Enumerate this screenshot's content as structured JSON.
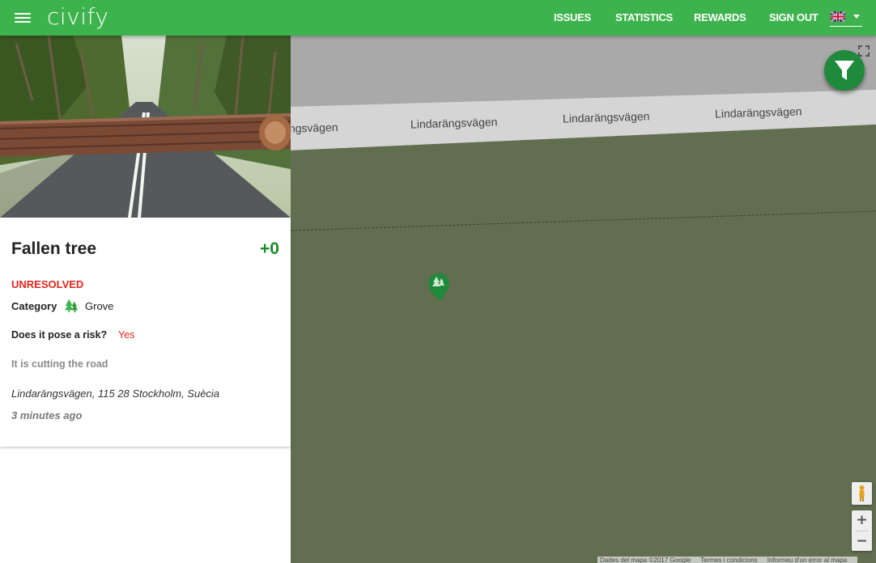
{
  "app": {
    "logo": "civify"
  },
  "nav": {
    "issues": "ISSUES",
    "statistics": "STATISTICS",
    "rewards": "REWARDS",
    "sign_out": "SIGN OUT"
  },
  "issue": {
    "title": "Fallen tree",
    "votes": "+0",
    "status": "UNRESOLVED",
    "category_label": "Category",
    "category_value": "Grove",
    "risk_question": "Does it pose a risk?",
    "risk_answer": "Yes",
    "description": "It is cutting the road",
    "address": "Lindarängsvägen, 115 28 Stockholm, Suècia",
    "time_ago": "3 minutes ago"
  },
  "map": {
    "road_labels": [
      "ängsvägen",
      "Lindarängsvägen",
      "Lindarängsvägen",
      "Lindarängsvägen"
    ],
    "zoom_in": "+",
    "zoom_out": "−",
    "attribution": {
      "data": "Dades del mapa ©2017 Google",
      "terms": "Termes i condicions",
      "report": "Informeu d'un error al mapa"
    }
  },
  "colors": {
    "header": "#3db34d",
    "status": "#e3261c",
    "votes": "#1e8a28",
    "map_background": "#616e4f",
    "fab": "#1f8a3c"
  },
  "icons": {
    "menu": "menu-icon",
    "flag": "uk-flag-icon",
    "filter": "filter-icon",
    "category": "trees-icon",
    "marker": "map-marker-icon",
    "fullscreen": "fullscreen-icon",
    "pegman": "pegman-icon"
  }
}
